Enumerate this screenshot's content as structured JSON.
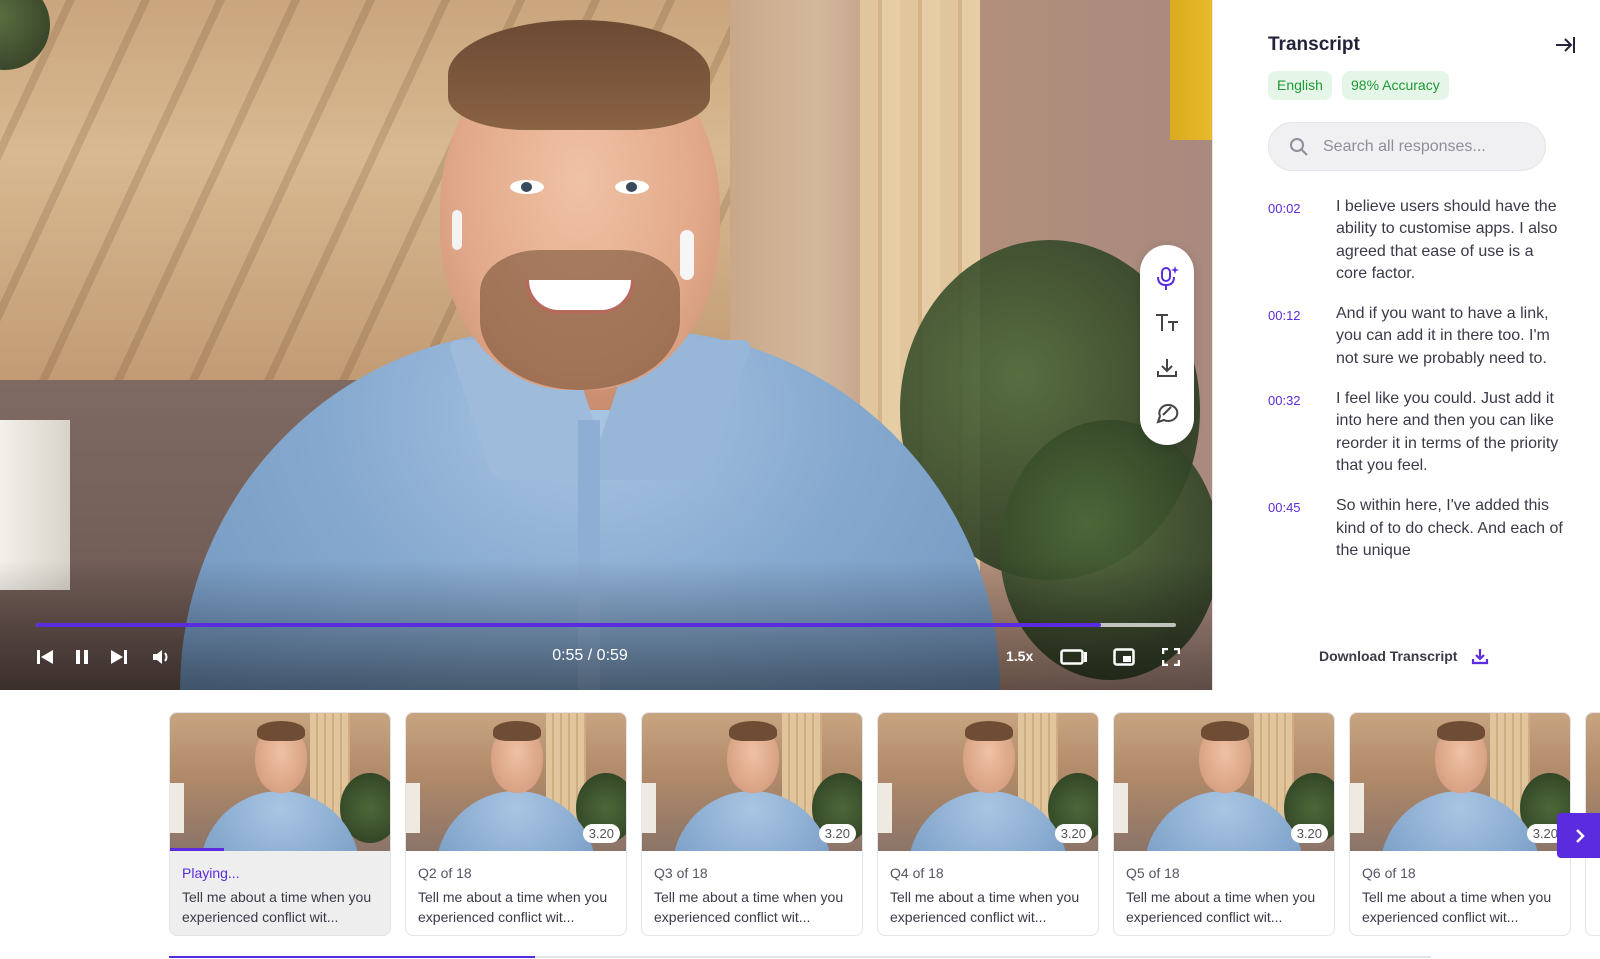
{
  "video": {
    "time_display": "0:55 / 0:59",
    "speed": "1.5x",
    "progress_fraction": 0.934
  },
  "tools": {
    "icons": [
      "ai-voice-icon",
      "text-size-icon",
      "download-icon",
      "highlight-icon"
    ]
  },
  "transcript": {
    "title": "Transcript",
    "language": "English",
    "accuracy": "98% Accuracy",
    "search_placeholder": "Search all responses...",
    "entries": [
      {
        "time": "00:02",
        "text": "I believe users should have the ability to customise apps. I also agreed that ease of use is a core factor."
      },
      {
        "time": "00:12",
        "text": "And if you want to have a link, you can add it in there too. I'm not sure we probably need to."
      },
      {
        "time": "00:32",
        "text": "I feel like you could. Just add it into here and then you can like reorder it in terms of the priority that you feel."
      },
      {
        "time": "00:45",
        "text": "So within here, I've added this kind of to do check. And each of the unique"
      }
    ],
    "download_label": "Download Transcript"
  },
  "questions": [
    {
      "subtitle": "Playing...",
      "duration": "",
      "text": "Tell me about a time when you experienced conflict wit...",
      "active": true
    },
    {
      "subtitle": "Q2 of 18",
      "duration": "3.20",
      "text": "Tell me about a time when you experienced conflict wit...",
      "active": false
    },
    {
      "subtitle": "Q3 of 18",
      "duration": "3.20",
      "text": "Tell me about a time when you experienced conflict wit...",
      "active": false
    },
    {
      "subtitle": "Q4 of 18",
      "duration": "3.20",
      "text": "Tell me about a time when you experienced conflict wit...",
      "active": false
    },
    {
      "subtitle": "Q5 of 18",
      "duration": "3.20",
      "text": "Tell me about a time when you experienced conflict wit...",
      "active": false
    },
    {
      "subtitle": "Q6 of 18",
      "duration": "3.20",
      "text": "Tell me about a time when you experienced conflict wit...",
      "active": false
    }
  ],
  "strip_scroll_fraction": 0.29,
  "colors": {
    "accent": "#5b2be0",
    "chip_bg": "#e5f6e8",
    "chip_text": "#1f9a34"
  }
}
